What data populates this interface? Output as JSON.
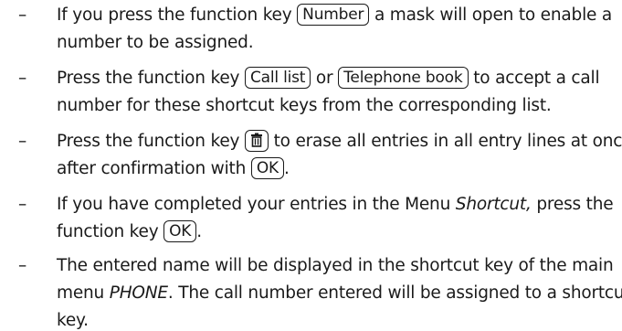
{
  "list": {
    "dash": "–",
    "item1": {
      "line1_a": "If you press the function key ",
      "key_number": "Number",
      "line1_b": " a mask will open to enable a",
      "line2": "number to be assigned."
    },
    "item2": {
      "line1_a": "Press the function key ",
      "key_call_list": "Call list",
      "line1_b": " or ",
      "key_telephone_book": "Telephone book",
      "line1_c": " to accept a call",
      "line2": "number for these shortcut keys from the corresponding list."
    },
    "item3": {
      "line1_a": "Press the function key ",
      "key_icon": "trash-icon",
      "line1_b": " to erase all entries in all entry lines at once",
      "line2_a": "after confirmation with ",
      "key_ok": "OK",
      "line2_b": "."
    },
    "item4": {
      "line1_a": "If you have completed your entries in the Menu ",
      "menu_name": "Shortcut,",
      "line1_b": " press the",
      "line2_a": "function key ",
      "key_ok": "OK",
      "line2_b": "."
    },
    "item5": {
      "line1_a": "The entered name will be displayed in the shortcut key of the main",
      "line2_a": "menu ",
      "menu_name": "PHONE",
      "line2_b": ". The call number entered will be assigned to a shortcut",
      "line3": "key."
    }
  }
}
